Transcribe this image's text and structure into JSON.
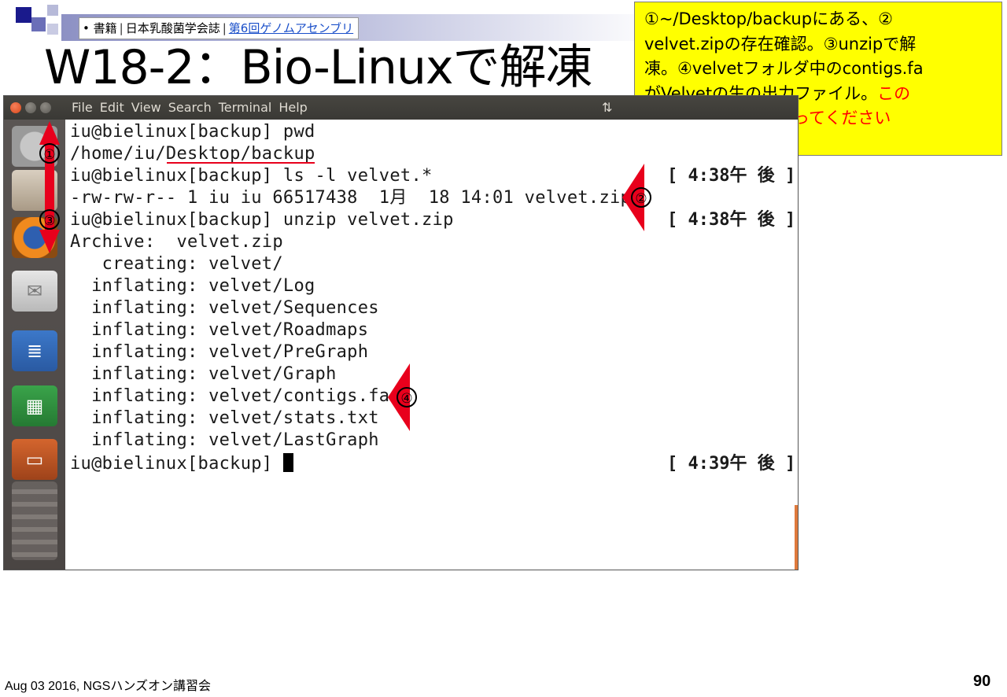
{
  "breadcrumb": {
    "bullet": "•",
    "item1": "書籍",
    "item2": "日本乳酸菌学会誌",
    "link": "第6回ゲノムアセンブリ"
  },
  "slide_title": "W18-2：Bio-Linuxで解凍",
  "callout": {
    "line1": "①~/Desktop/backupにある、②",
    "line2": "velvet.zipの存在確認。③unzipで解",
    "line3": "凍。④velvetフォルダ中のcontigs.fa",
    "line4": "がVelvetの生の出力ファイル。",
    "line4_red": "この",
    "line5_red": "あたりは手打ちでやってください"
  },
  "terminal": {
    "menu": [
      "File",
      "Edit",
      "View",
      "Search",
      "Terminal",
      "Help"
    ],
    "titlebar_glyph": "⇅",
    "lines": [
      "iu@bielinux[backup] pwd",
      "/home/iu/Desktop/backup",
      "iu@bielinux[backup] ls -l velvet.*",
      "-rw-rw-r-- 1 iu iu 66517438  1月  18 14:01 velvet.zip",
      "iu@bielinux[backup] unzip velvet.zip",
      "Archive:  velvet.zip",
      "   creating: velvet/",
      "  inflating: velvet/Log",
      "  inflating: velvet/Sequences",
      "  inflating: velvet/Roadmaps",
      "  inflating: velvet/PreGraph",
      "  inflating: velvet/Graph",
      "  inflating: velvet/contigs.fa",
      "  inflating: velvet/stats.txt",
      "  inflating: velvet/LastGraph",
      "iu@bielinux[backup] "
    ],
    "timestamps": [
      "[ 4:38午 後 ]",
      "[ 4:38午 後 ]",
      "[ 4:39午 後 ]"
    ]
  },
  "markers": [
    "①",
    "②",
    "③",
    "④"
  ],
  "footer": {
    "left": "Aug 03 2016, NGSハンズオン講習会",
    "page": "90"
  }
}
